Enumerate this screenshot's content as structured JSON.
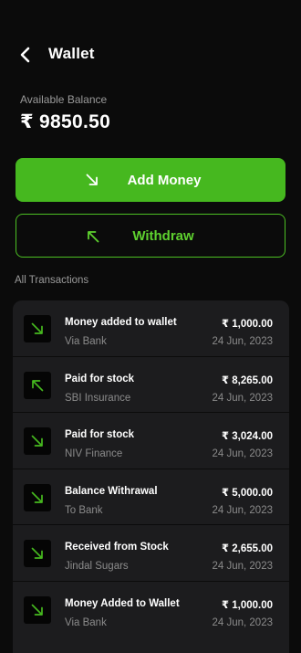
{
  "header": {
    "title": "Wallet"
  },
  "balance": {
    "label": "Available Balance",
    "value": "₹ 9850.50"
  },
  "actions": {
    "add_label": "Add Money",
    "withdraw_label": "Withdraw"
  },
  "transactions_title": "All Transactions",
  "colors": {
    "accent": "#46b81f",
    "accent_light": "#5ed12f",
    "background": "#0b0b0b",
    "card": "#1c1c1e"
  },
  "transactions": [
    {
      "title": "Money added to wallet",
      "subtitle": "Via Bank",
      "amount": "₹ 1,000.00",
      "date": "24 Jun, 2023",
      "direction": "in",
      "icon": "arrow-down-right-icon"
    },
    {
      "title": "Paid for stock",
      "subtitle": "SBI Insurance",
      "amount": "₹ 8,265.00",
      "date": "24 Jun, 2023",
      "direction": "out",
      "icon": "arrow-up-left-icon"
    },
    {
      "title": "Paid for stock",
      "subtitle": "NIV Finance",
      "amount": "₹ 3,024.00",
      "date": "24 Jun, 2023",
      "direction": "in",
      "icon": "arrow-down-right-icon"
    },
    {
      "title": "Balance Withrawal",
      "subtitle": "To Bank",
      "amount": "₹ 5,000.00",
      "date": "24 Jun, 2023",
      "direction": "in",
      "icon": "arrow-down-right-icon"
    },
    {
      "title": "Received from Stock",
      "subtitle": "Jindal Sugars",
      "amount": "₹ 2,655.00",
      "date": "24 Jun, 2023",
      "direction": "in",
      "icon": "arrow-down-right-icon"
    },
    {
      "title": "Money Added to Wallet",
      "subtitle": "Via Bank",
      "amount": "₹ 1,000.00",
      "date": "24 Jun, 2023",
      "direction": "in",
      "icon": "arrow-down-right-icon"
    }
  ]
}
